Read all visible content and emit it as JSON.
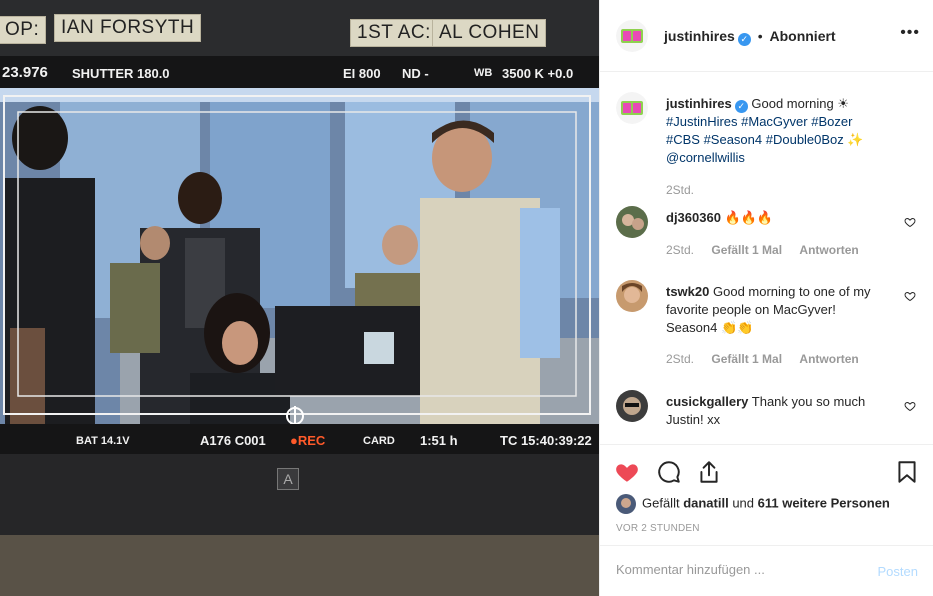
{
  "photo": {
    "tape_left": "OP:",
    "tape_dop": "IAN FORSYTH",
    "tape_ac_label": "1ST AC:",
    "tape_ac_name": "AL COHEN",
    "hud": {
      "top_left": "23.976",
      "shutter": "SHUTTER 180.0",
      "ei": "EI 800",
      "nd": "ND -",
      "wb": "WB",
      "wb_value": "3500 K +0.0",
      "bat": "BAT 14.1V",
      "clip": "A176 C001",
      "rec": "●REC",
      "card": "CARD",
      "card_time": "1:51 h",
      "tc": "TC 15:40:39:22",
      "monitor_label": "A"
    }
  },
  "header": {
    "username": "justinhires",
    "verified_icon": "verified-badge-icon",
    "separator": "•",
    "follow_status": "Abonniert",
    "more_icon": "more-options-icon"
  },
  "caption": {
    "username": "justinhires",
    "text_start": "Good morning ",
    "hashtags": "#JustinHires #MacGyver #Bozer #CBS #Season4 #Double0Boz",
    "mention": "@cornellwillis",
    "time": "2Std."
  },
  "comments": [
    {
      "username": "dj360360",
      "text": "💧💧💧",
      "time": "2Std.",
      "likes": "Gefällt 1 Mal",
      "reply": "Antworten"
    },
    {
      "username": "tswk20",
      "text": "Good morning to one of my favorite people on MacGyver! Season4 ",
      "time": "2Std.",
      "likes": "Gefällt 1 Mal",
      "reply": "Antworten"
    },
    {
      "username": "cusickgallery",
      "text": "Thank you so much Justin! xx"
    }
  ],
  "actions": {
    "liked_by_prefix": "Gefällt ",
    "liked_by_user": "danatill",
    "liked_by_mid": " und ",
    "liked_by_count": "611 weitere Personen",
    "time_ago": "VOR 2 STUNDEN"
  },
  "comment_box": {
    "placeholder": "Kommentar hinzufügen ...",
    "post_label": "Posten"
  },
  "colors": {
    "like_red": "#ed4956",
    "link_blue": "#003569",
    "verified_blue": "#3897f0",
    "post_disabled": "#b3dbff"
  }
}
